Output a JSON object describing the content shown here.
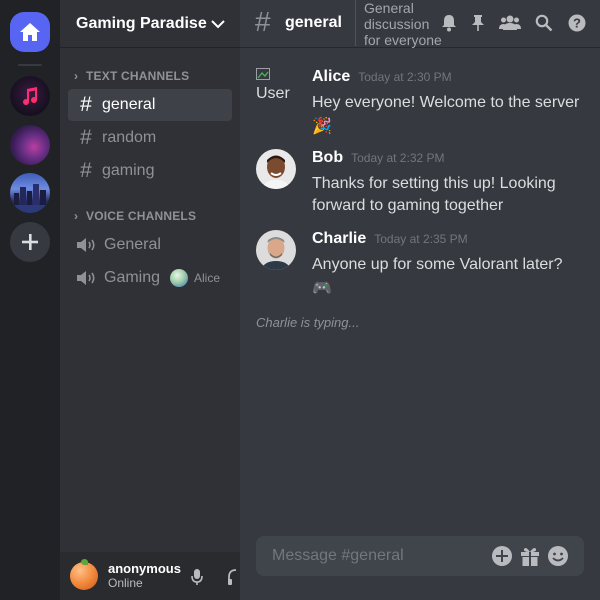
{
  "servers": [
    {
      "name": "home",
      "icon": "home-icon"
    },
    {
      "name": "music-server",
      "icon": "music-note-icon"
    },
    {
      "name": "neon-server"
    },
    {
      "name": "city-server"
    },
    {
      "name": "add-server",
      "icon": "plus-icon"
    }
  ],
  "guild": {
    "name": "Gaming Paradise",
    "chevron_icon": "chevron-down-icon"
  },
  "categories": {
    "text": "TEXT CHANNELS",
    "voice": "VOICE CHANNELS"
  },
  "text_channels": [
    {
      "label": "general",
      "active": true
    },
    {
      "label": "random",
      "active": false
    },
    {
      "label": "gaming",
      "active": false
    }
  ],
  "voice_channels": [
    {
      "label": "General"
    },
    {
      "label": "Gaming",
      "members": [
        "Alice"
      ]
    }
  ],
  "user_panel": {
    "name": "anonymous",
    "status": "Online"
  },
  "channel_header": {
    "hash": "#",
    "name": "general",
    "topic": "General discussion for everyone",
    "icons": [
      "bell-icon",
      "pin-icon",
      "members-icon",
      "search-icon",
      "help-icon"
    ]
  },
  "messages": [
    {
      "author": "Alice",
      "timestamp": "Today at 2:30 PM",
      "text": "Hey everyone! Welcome to the server",
      "emoji": "🎉",
      "avatar_alt": "User"
    },
    {
      "author": "Bob",
      "timestamp": "Today at 2:32 PM",
      "text": "Thanks for setting this up! Looking forward to gaming together"
    },
    {
      "author": "Charlie",
      "timestamp": "Today at 2:35 PM",
      "text": "Anyone up for some Valorant later?",
      "emoji": "🎮"
    }
  ],
  "typing_indicator": "Charlie is typing...",
  "composer": {
    "placeholder": "Message #general",
    "icons": [
      "add-icon",
      "gift-icon",
      "emoji-icon"
    ]
  },
  "colors": {
    "accent": "#5865f2",
    "background": "#36393f",
    "sidebar": "#2f3136",
    "rail": "#202225"
  }
}
